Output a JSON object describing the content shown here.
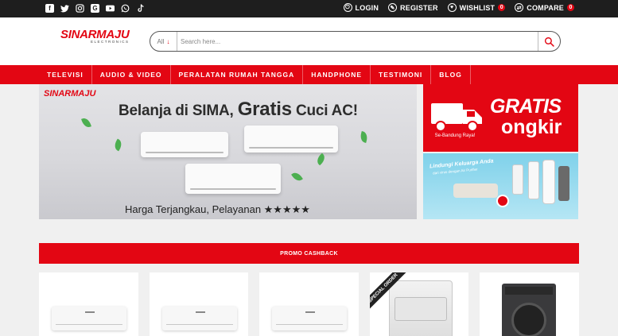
{
  "topbar": {
    "social_icons": [
      "facebook-icon",
      "twitter-icon",
      "instagram-icon",
      "google-plus-icon",
      "youtube-icon",
      "whatsapp-icon",
      "tiktok-icon"
    ],
    "links": [
      {
        "label": "LOGIN",
        "icon": "power-icon"
      },
      {
        "label": "REGISTER",
        "icon": "edit-icon"
      },
      {
        "label": "WISHLIST",
        "icon": "heart-icon",
        "count": "0"
      },
      {
        "label": "COMPARE",
        "icon": "compare-icon",
        "count": "0"
      }
    ]
  },
  "header": {
    "logo_text": "SINARMAJU",
    "logo_subtext": "ELECTRONICS",
    "search_category": "All",
    "search_placeholder": "Search here..."
  },
  "nav": {
    "items": [
      "TELEVISI",
      "AUDIO & VIDEO",
      "PERALATAN RUMAH TANGGA",
      "HANDPHONE",
      "TESTIMONI",
      "BLOG"
    ]
  },
  "banner_main": {
    "logo_text": "SINARMAJU",
    "headline_part1": "Belanja di SIMA, ",
    "headline_part2": "Gratis",
    "headline_part3": " Cuci AC!",
    "tagline": "Harga Terjangkau, Pelayanan ★★★★★"
  },
  "banner_side1": {
    "title": "GRATIS",
    "subtitle": "ongkir",
    "area": "Se-Bandung Raya!"
  },
  "banner_side2": {
    "title": "Lindungi Keluarga Anda",
    "subtitle": "dari virus dengan Air Purifier"
  },
  "promo": {
    "title": "PROMO CASHBACK"
  },
  "products": {
    "ribbon": "SPECIAL ORDER"
  },
  "colors": {
    "brand_red": "#e30613",
    "topbar_bg": "#1e1e1e"
  }
}
